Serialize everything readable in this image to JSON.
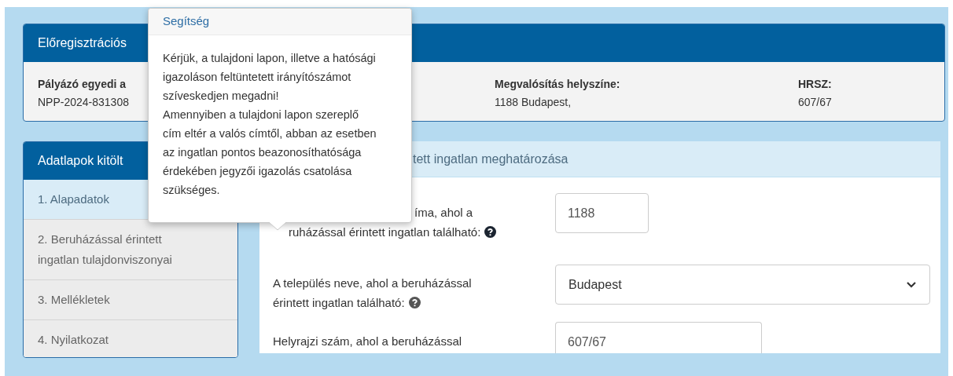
{
  "summary_panel": {
    "title": "Előregisztrációs",
    "items": [
      {
        "label": "Pályázó egyedi a",
        "value": "NPP-2024-831308"
      },
      {
        "label": "Megvalósítás helyszíne:",
        "value": "1188 Budapest,"
      },
      {
        "label": "HRSZ:",
        "value": "607/67"
      }
    ]
  },
  "sidebar": {
    "title": "Adatlapok kitölt",
    "items": [
      {
        "label": "1. Alapadatok",
        "selected": true
      },
      {
        "label": "2. Beruházással érintett ingatlan tulajdonviszonyai",
        "selected": false
      },
      {
        "label": "3. Mellékletek",
        "selected": false
      },
      {
        "label": "4. Nyilatkozat",
        "selected": false
      }
    ]
  },
  "section": {
    "title": "tett ingatlan meghatározása",
    "fields": [
      {
        "kind": "text",
        "label_fragments": [
          "íma, ahol a",
          "ruházással érintett ingatlan található:"
        ],
        "help": true,
        "value": "1188"
      },
      {
        "kind": "select",
        "label_fragments": [
          "A település neve, ahol a beruházással",
          "érintett ingatlan található:"
        ],
        "help": true,
        "value": "Budapest"
      },
      {
        "kind": "text",
        "label_fragments": [
          "Helyrajzi szám, ahol a beruházással"
        ],
        "value": "607/67"
      }
    ]
  },
  "tooltip": {
    "title": "Segítség",
    "paragraphs": [
      "Kérjük, a tulajdoni lapon, illetve a hatósági igazoláson feltüntetett irányítószámot szíveskedjen megadni!",
      "Amennyiben a tulajdoni lapon szereplő cím eltér a valós címtől, abban az esetben az ingatlan pontos beazonosíthatósága érdekében jegyzői igazolás csatolása szükséges."
    ]
  }
}
